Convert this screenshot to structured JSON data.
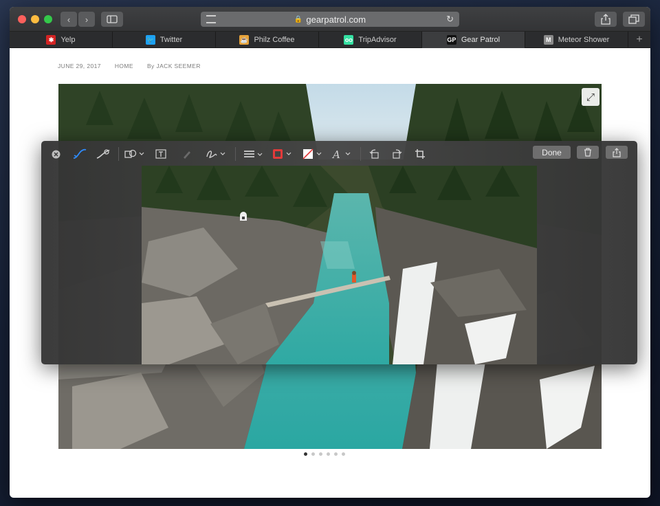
{
  "browser": {
    "url": "gearpatrol.com",
    "tabs": [
      {
        "label": "Yelp",
        "icon": "yelp-icon",
        "color": "#d32323",
        "glyph": "✱"
      },
      {
        "label": "Twitter",
        "icon": "twitter-icon",
        "color": "#1da1f2",
        "glyph": "🐦"
      },
      {
        "label": "Philz Coffee",
        "icon": "philz-coffee-icon",
        "color": "#e7a33a",
        "glyph": "☕"
      },
      {
        "label": "TripAdvisor",
        "icon": "tripadvisor-icon",
        "color": "#34e0a1",
        "glyph": "oo"
      },
      {
        "label": "Gear Patrol",
        "icon": "gear-patrol-icon",
        "color": "#111111",
        "glyph": "GP"
      },
      {
        "label": "Meteor Shower",
        "icon": "meteor-shower-icon",
        "color": "#8a8a8a",
        "glyph": "M"
      }
    ],
    "active_tab": 4,
    "new_tab_glyph": "+"
  },
  "article": {
    "date": "JUNE 29, 2017",
    "section": "HOME",
    "byline": "By JACK SEEMER"
  },
  "gallery": {
    "slide_count": 6,
    "current_slide": 0
  },
  "markup_toolbar": {
    "done_label": "Done",
    "tools": [
      "close-icon",
      "sketch-icon",
      "draw-icon",
      "shapes-icon",
      "text-icon",
      "highlight-icon",
      "sign-icon",
      "line-style-icon",
      "border-color-icon",
      "fill-color-icon",
      "text-style-icon",
      "rotate-left-icon",
      "rotate-right-icon",
      "crop-icon"
    ]
  },
  "colors": {
    "accent_blue": "#2f8cff",
    "border_red": "#e23a3a"
  }
}
